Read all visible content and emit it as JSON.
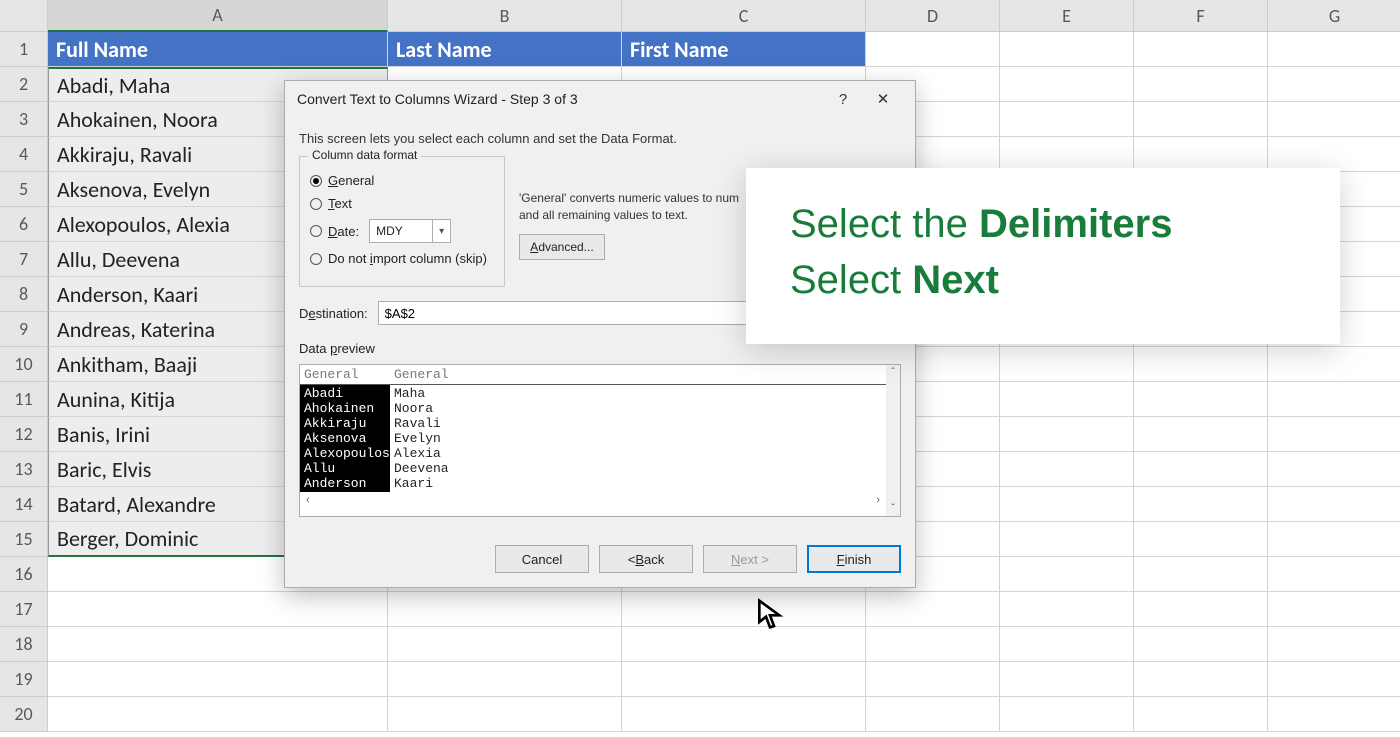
{
  "spreadsheet": {
    "columns": [
      "A",
      "B",
      "C",
      "D",
      "E",
      "F",
      "G"
    ],
    "headers": {
      "A": "Full Name",
      "B": "Last Name",
      "C": "First Name"
    },
    "rows": [
      "Abadi, Maha",
      "Ahokainen, Noora",
      "Akkiraju, Ravali",
      "Aksenova, Evelyn",
      "Alexopoulos, Alexia",
      "Allu, Deevena",
      "Anderson, Kaari",
      "Andreas, Katerina",
      "Ankitham, Baaji",
      "Aunina, Kitija",
      "Banis, Irini",
      "Baric, Elvis",
      "Batard, Alexandre",
      "Berger, Dominic"
    ],
    "total_visible_rows": 20
  },
  "dialog": {
    "title": "Convert Text to Columns Wizard - Step 3 of 3",
    "description": "This screen lets you select each column and set the Data Format.",
    "format_legend": "Column data format",
    "radios": {
      "general": "General",
      "text": "Text",
      "date": "Date:",
      "skip": "Do not import column (skip)"
    },
    "date_format": "MDY",
    "hint_line1": "'General' converts numeric values to num",
    "hint_line2": "and all remaining values to text.",
    "advanced": "Advanced...",
    "destination_label": "Destination:",
    "destination_value": "$A$2",
    "preview_label": "Data preview",
    "preview_hdr1": "General",
    "preview_hdr2": "General",
    "preview_col1": [
      "Abadi",
      "Ahokainen",
      "Akkiraju",
      "Aksenova",
      "Alexopoulos",
      "Allu",
      "Anderson"
    ],
    "preview_col2": [
      "Maha",
      "Noora",
      "Ravali",
      "Evelyn",
      "Alexia",
      "Deevena",
      "Kaari"
    ],
    "buttons": {
      "cancel": "Cancel",
      "back": "< Back",
      "next": "Next >",
      "finish": "Finish"
    }
  },
  "instruction": {
    "line1_a": "Select the ",
    "line1_b": "Delimiters",
    "line2_a": "Select ",
    "line2_b": "Next"
  }
}
